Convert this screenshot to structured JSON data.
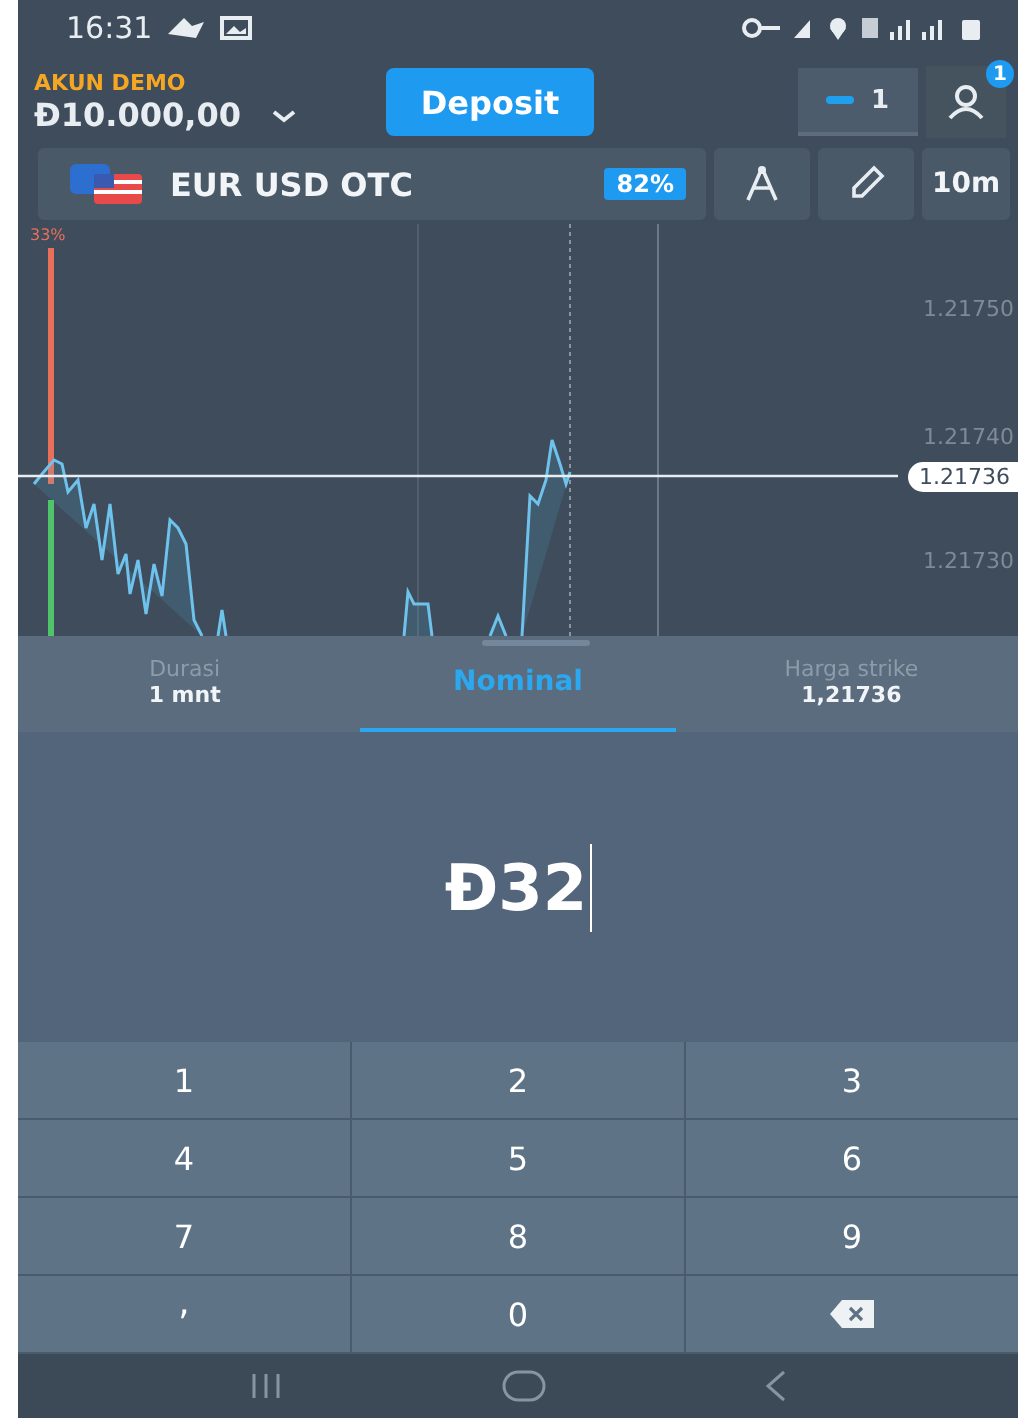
{
  "status_bar": {
    "time": "16:31"
  },
  "account": {
    "label": "AKUN DEMO",
    "balance": "Đ10.000,00"
  },
  "deposit_button": "Deposit",
  "trades_count": "1",
  "profile_badge": "1",
  "asset": {
    "name": "EUR USD OTC",
    "payout": "82%"
  },
  "timeframe": "10m",
  "chart": {
    "sentiment": "33%",
    "y_labels": [
      "1.21750",
      "1.21740",
      "1.21730"
    ],
    "current_price": "1.21736"
  },
  "tabs": [
    {
      "label": "Durasi",
      "value": "1 mnt",
      "selected": false
    },
    {
      "label": "Nominal",
      "selected": true
    },
    {
      "label": "Harga strike",
      "value": "1,21736",
      "selected": false
    }
  ],
  "amount": "Đ32",
  "keypad": [
    {
      "kind": "digit",
      "label": "1"
    },
    {
      "kind": "digit",
      "label": "2"
    },
    {
      "kind": "digit",
      "label": "3"
    },
    {
      "kind": "digit",
      "label": "4"
    },
    {
      "kind": "digit",
      "label": "5"
    },
    {
      "kind": "digit",
      "label": "6"
    },
    {
      "kind": "digit",
      "label": "7"
    },
    {
      "kind": "digit",
      "label": "8"
    },
    {
      "kind": "digit",
      "label": "9"
    },
    {
      "kind": "decimal",
      "label": ","
    },
    {
      "kind": "digit",
      "label": "0"
    },
    {
      "kind": "backspace"
    }
  ]
}
